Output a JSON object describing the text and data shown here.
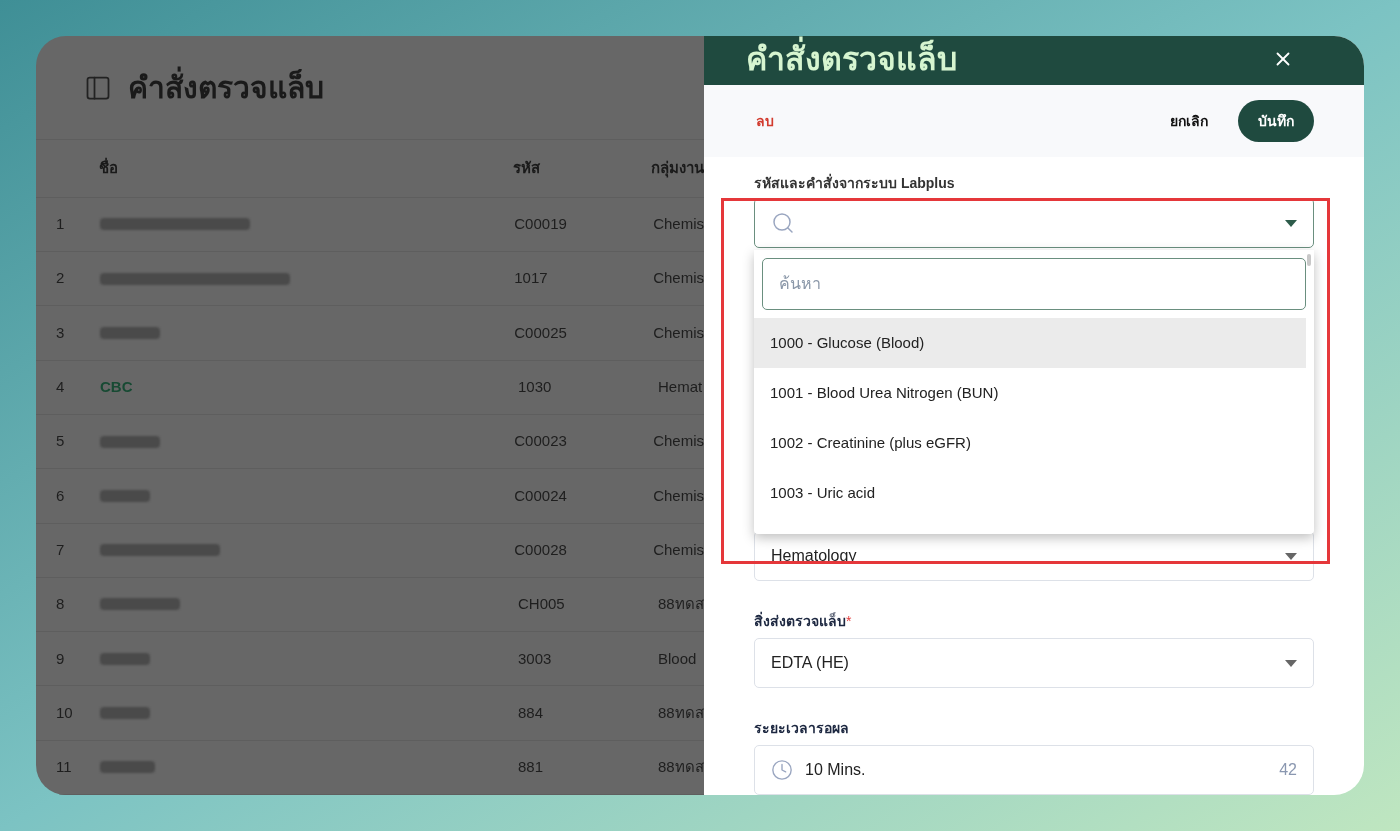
{
  "page": {
    "title": "คำสั่งตรวจแล็บ"
  },
  "table": {
    "columns": [
      "ชื่อ",
      "รหัส",
      "กลุ่มงาน"
    ],
    "rows": [
      {
        "index": "1",
        "name_blurred": true,
        "code": "C00019",
        "group": "Chemis"
      },
      {
        "index": "2",
        "name_blurred": true,
        "code": "1017",
        "group": "Chemis"
      },
      {
        "index": "3",
        "name_blurred": true,
        "code": "C00025",
        "group": "Chemis"
      },
      {
        "index": "4",
        "name": "CBC",
        "code": "1030",
        "group": "Hemat"
      },
      {
        "index": "5",
        "name_blurred": true,
        "code": "C00023",
        "group": "Chemis"
      },
      {
        "index": "6",
        "name_blurred": true,
        "code": "C00024",
        "group": "Chemis"
      },
      {
        "index": "7",
        "name_blurred": true,
        "code": "C00028",
        "group": "Chemis"
      },
      {
        "index": "8",
        "name_blurred": true,
        "code": "CH005",
        "group": "88ทดส"
      },
      {
        "index": "9",
        "name_blurred": true,
        "code": "3003",
        "group": "Blood"
      },
      {
        "index": "10",
        "name_blurred": true,
        "code": "884",
        "group": "88ทดส"
      },
      {
        "index": "11",
        "name_blurred": true,
        "code": "881",
        "group": "88ทดส"
      }
    ]
  },
  "drawer": {
    "title": "คำสั่งตรวจแล็บ",
    "delete": "ลบ",
    "cancel": "ยกเลิก",
    "save": "บันทึก",
    "lookup": {
      "label": "รหัสและคำสั่งจากระบบ Labplus",
      "search_placeholder": "ค้นหา",
      "options": [
        {
          "label": "1000 - Glucose (Blood)",
          "selected": true
        },
        {
          "label": "1001 - Blood Urea Nitrogen (BUN)",
          "selected": false
        },
        {
          "label": "1002 - Creatinine (plus eGFR)",
          "selected": false
        },
        {
          "label": "1003 - Uric acid",
          "selected": false
        }
      ]
    },
    "group_value": "Hematology",
    "specimen": {
      "label": "สิ่งส่งตรวจแล็บ",
      "required_mark": "*",
      "value": "EDTA (HE)"
    },
    "turnaround": {
      "label": "ระยะเวลารอผล",
      "value": "10 Mins.",
      "count": "42"
    }
  },
  "highlight": true
}
